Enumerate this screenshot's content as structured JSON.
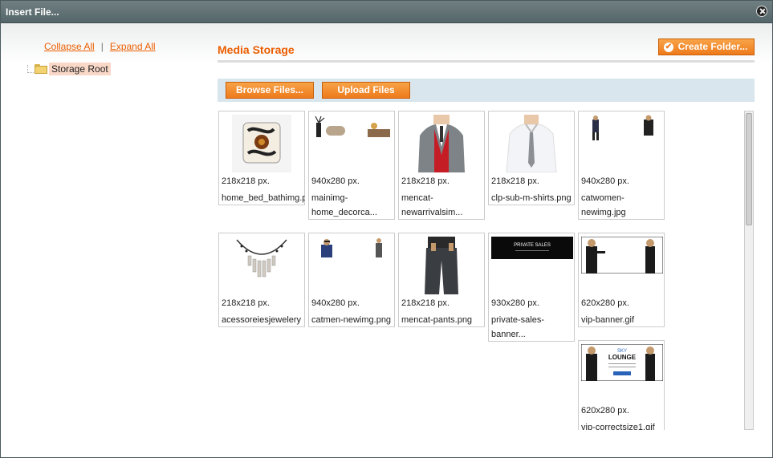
{
  "window": {
    "title": "Insert File..."
  },
  "tree": {
    "collapse_all": "Collapse All",
    "separator": "|",
    "expand_all": "Expand All",
    "root_label": "Storage Root"
  },
  "main": {
    "title": "Media Storage",
    "create_folder": "Create Folder...",
    "browse_files": "Browse Files...",
    "upload_files": "Upload Files"
  },
  "files": [
    {
      "dims": "218x218 px.",
      "name": "home_bed_bathimg.p"
    },
    {
      "dims": "940x280 px.",
      "name": "mainimg-home_decorca..."
    },
    {
      "dims": "218x218 px.",
      "name": "mencat-newarrivalsim..."
    },
    {
      "dims": "218x218 px.",
      "name": "clp-sub-m-shirts.png"
    },
    {
      "dims": "940x280 px.",
      "name": "catwomen-newimg.jpg"
    },
    {
      "dims": "218x218 px.",
      "name": "acessoreiesjewelery"
    },
    {
      "dims": "940x280 px.",
      "name": "catmen-newimg.png"
    },
    {
      "dims": "218x218 px.",
      "name": "mencat-pants.png"
    },
    {
      "dims": "930x280 px.",
      "name": "private-sales-banner..."
    },
    {
      "dims": "620x280 px.",
      "name": "vip-banner.gif"
    },
    {
      "dims": "620x280 px.",
      "name": "vip-correctsize1.gif"
    }
  ],
  "thumb_text": {
    "private_sales": "PRIVATE SALES",
    "sky": "SKY",
    "lounge": "LOUNGE"
  },
  "colors": {
    "accent": "#eb5e00",
    "button": "#ee7a1b",
    "toolbar": "#d9e6ee",
    "titlebar": "#5f6f72"
  }
}
